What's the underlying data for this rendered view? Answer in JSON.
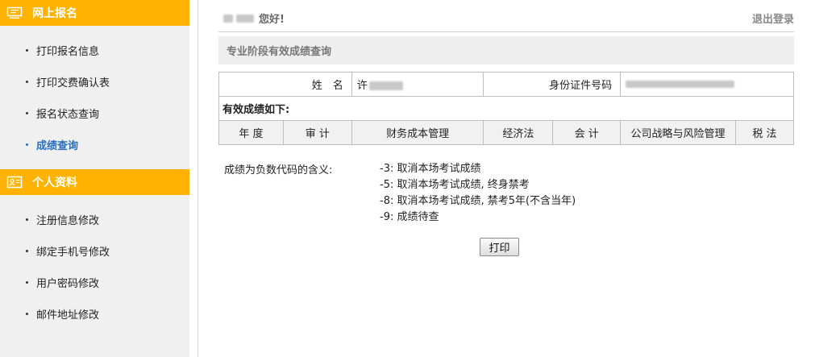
{
  "sidebar": {
    "section1": {
      "title": "网上报名",
      "icon": "monitor-icon",
      "items": [
        {
          "label": "打印报名信息",
          "active": false
        },
        {
          "label": "打印交费确认表",
          "active": false
        },
        {
          "label": "报名状态查询",
          "active": false
        },
        {
          "label": "成绩查询",
          "active": true
        }
      ]
    },
    "section2": {
      "title": "个人资料",
      "icon": "id-card-icon",
      "items": [
        {
          "label": "注册信息修改",
          "active": false
        },
        {
          "label": "绑定手机号修改",
          "active": false
        },
        {
          "label": "用户密码修改",
          "active": false
        },
        {
          "label": "邮件地址修改",
          "active": false
        }
      ]
    }
  },
  "header": {
    "greeting": "您好!",
    "logout": "退出登录"
  },
  "page_title": "专业阶段有效成绩查询",
  "info": {
    "name_label": "姓　名",
    "name_value": "许",
    "id_label": "身份证件号码"
  },
  "scores": {
    "caption": "有效成绩如下:",
    "columns": [
      "年 度",
      "审 计",
      "财务成本管理",
      "经济法",
      "会 计",
      "公司战略与风险管理",
      "税 法"
    ]
  },
  "legend": {
    "label": "成绩为负数代码的含义:",
    "codes": [
      "-3: 取消本场考试成绩",
      "-5: 取消本场考试成绩, 终身禁考",
      "-8: 取消本场考试成绩, 禁考5年(不含当年)",
      "-9: 成绩待查"
    ]
  },
  "print_label": "打印",
  "colors": {
    "accent": "#ffb300",
    "active_link": "#2a6fbd"
  }
}
